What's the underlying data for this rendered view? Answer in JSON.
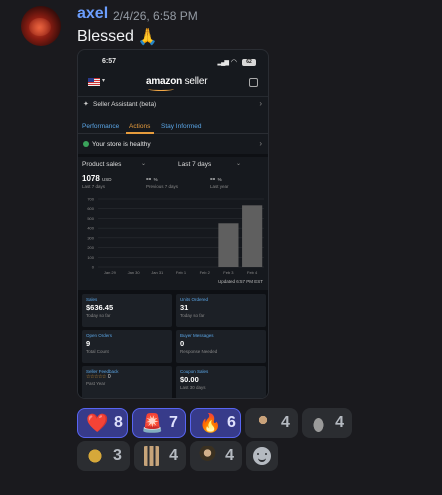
{
  "message": {
    "username": "axel",
    "timestamp": "2/4/26, 6:58 PM",
    "text": "Blessed",
    "text_emoji": "🙏"
  },
  "screenshot": {
    "status_time": "6:57",
    "battery": "62",
    "logo_bold": "amazon",
    "logo_light": " seller",
    "seller_assistant": "Seller Assistant (beta)",
    "tabs": [
      "Performance",
      "Actions",
      "Stay Informed"
    ],
    "active_tab": "Actions",
    "store_status": "Your store is healthy",
    "filter_metric": "Product sales",
    "filter_range": "Last 7 days",
    "metrics": [
      {
        "value": "1078",
        "unit": "USD",
        "sub": "Last 7 days"
      },
      {
        "value": "-- ",
        "unit": "%",
        "sub": "Previous 7 days"
      },
      {
        "value": "-- ",
        "unit": "%",
        "sub": "Last year"
      }
    ],
    "updated": "Updated 6:57 PM EST",
    "cards": [
      {
        "title": "Sales",
        "value": "$636.45",
        "sub": "Today so far"
      },
      {
        "title": "Units Ordered",
        "value": "31",
        "sub": "Today so far"
      },
      {
        "title": "Open Orders",
        "value": "9",
        "sub": "Total Count"
      },
      {
        "title": "Buyer Messages",
        "value": "0",
        "sub": "Response Needed"
      },
      {
        "title": "Seller Feedback",
        "value": "☆☆☆☆☆",
        "rating": "0",
        "sub": "Past Year"
      },
      {
        "title": "Coupon Sales",
        "value": "$0.00",
        "sub": "Last 30 days"
      }
    ]
  },
  "chart_data": {
    "type": "bar",
    "categories": [
      "Jan 29",
      "Jan 30",
      "Jan 31",
      "Feb 1",
      "Feb 2",
      "Feb 3",
      "Feb 4"
    ],
    "values": [
      0,
      0,
      0,
      0,
      0,
      450,
      635
    ],
    "yticks": [
      0,
      100,
      200,
      300,
      400,
      500,
      600,
      700
    ],
    "ylim": [
      0,
      700
    ],
    "grid": true,
    "colors": {
      "bar": "#5f5f5f",
      "grid": "#2f3338",
      "axis_text": "#8a8a8a"
    }
  },
  "reactions": [
    {
      "emoji": "❤️",
      "count": "8",
      "mine": true
    },
    {
      "emoji": "🚨",
      "count": "7",
      "mine": true
    },
    {
      "emoji": "🔥",
      "count": "6",
      "mine": true
    },
    {
      "emoji": "custom-man-emote",
      "count": "4",
      "mine": false
    },
    {
      "emoji": "custom-car-emote",
      "count": "4",
      "mine": false
    },
    {
      "emoji": "custom-gold-emote",
      "count": "3",
      "mine": false
    },
    {
      "emoji": "custom-hands-emote",
      "count": "4",
      "mine": false
    },
    {
      "emoji": "custom-portrait-emote",
      "count": "4",
      "mine": false
    }
  ],
  "colors": {
    "username": "#6b9dfc",
    "reaction_selected_bg": "#373b8a",
    "reaction_selected_border": "#5865f2",
    "amazon_orange": "#e69b3c"
  }
}
